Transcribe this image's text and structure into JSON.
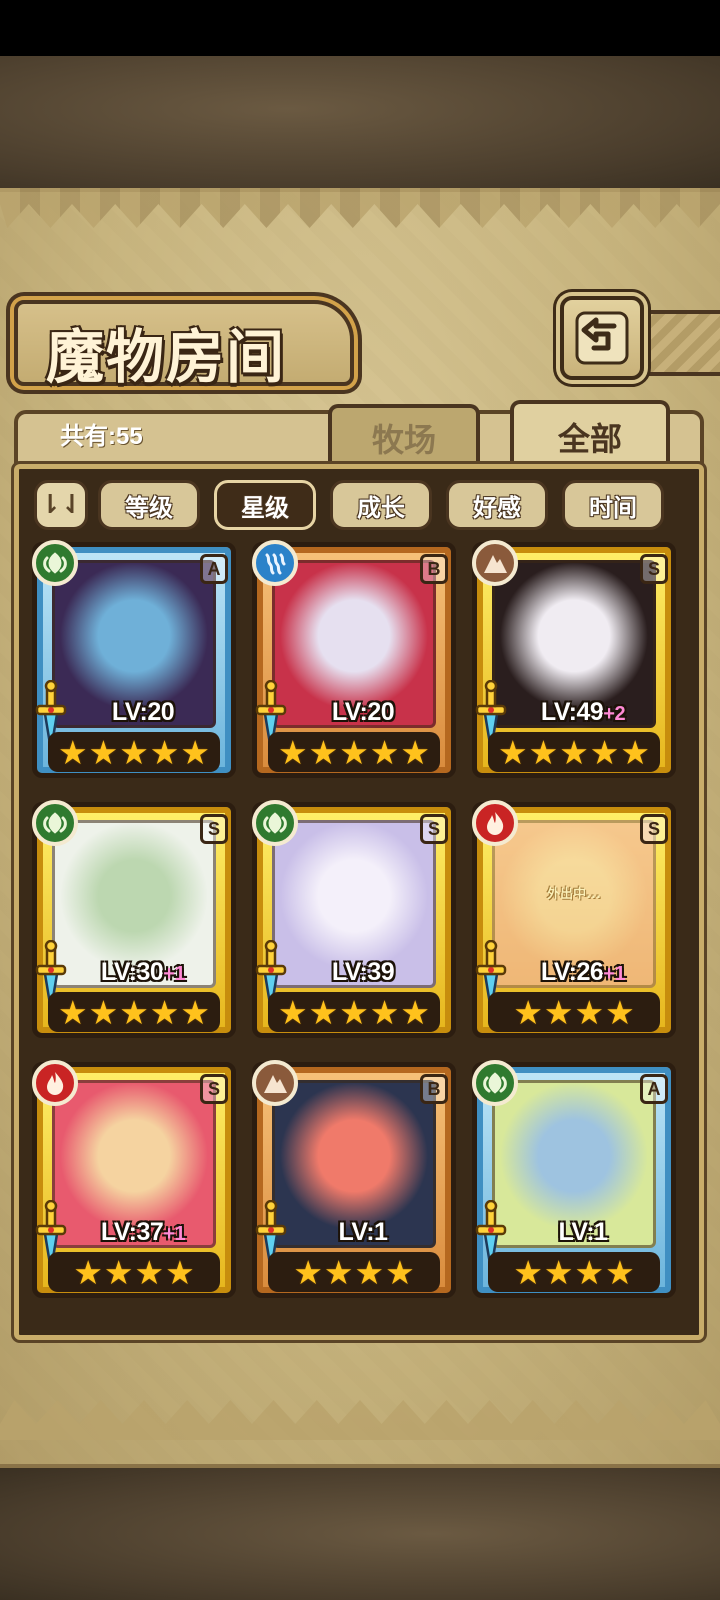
{
  "title": "魔物房间",
  "count_label": "共有:55",
  "tabs": {
    "ranch": "牧场",
    "all": "全部"
  },
  "sort": {
    "toggle": "⇂⇃",
    "buttons": [
      "等级",
      "星级",
      "成长",
      "好感",
      "时间"
    ],
    "active": "星级"
  },
  "colors": {
    "A": "#6ab4dc",
    "B": "#d98b3c",
    "S": "#e6b51c"
  },
  "monsters": [
    {
      "rank": "A",
      "element": "wood",
      "lv": "LV:20",
      "plus": "",
      "stars": 5,
      "away": "",
      "portrait": [
        "#3b2a55",
        "#6fb0d8"
      ]
    },
    {
      "rank": "B",
      "element": "water",
      "lv": "LV:20",
      "plus": "",
      "stars": 5,
      "away": "",
      "portrait": [
        "#c8324a",
        "#e6e0f0"
      ]
    },
    {
      "rank": "S",
      "element": "earth",
      "lv": "LV:49",
      "plus": "+2",
      "stars": 5,
      "away": "",
      "portrait": [
        "#2a1e1e",
        "#f0ecf2"
      ]
    },
    {
      "rank": "S",
      "element": "wood",
      "lv": "LV:30",
      "plus": "+1",
      "stars": 5,
      "away": "",
      "portrait": [
        "#eef2ea",
        "#bcd7b0"
      ]
    },
    {
      "rank": "S",
      "element": "wood",
      "lv": "LV:39",
      "plus": "",
      "stars": 5,
      "away": "",
      "portrait": [
        "#c9bfe8",
        "#f4f0fa"
      ]
    },
    {
      "rank": "S",
      "element": "fire",
      "lv": "LV:26",
      "plus": "+1",
      "stars": 4,
      "away": "外出中...",
      "portrait": [
        "#f2b1a8",
        "#f6d6c9"
      ]
    },
    {
      "rank": "S",
      "element": "fire",
      "lv": "LV:37",
      "plus": "+1",
      "stars": 4,
      "away": "",
      "portrait": [
        "#e85a6e",
        "#f5d3a0"
      ]
    },
    {
      "rank": "B",
      "element": "earth",
      "lv": "LV:1",
      "plus": "",
      "stars": 4,
      "away": "",
      "portrait": [
        "#2c3550",
        "#f07a6a"
      ]
    },
    {
      "rank": "A",
      "element": "wood",
      "lv": "LV:1",
      "plus": "",
      "stars": 4,
      "away": "",
      "portrait": [
        "#d8e89a",
        "#9ec3e0"
      ]
    }
  ]
}
